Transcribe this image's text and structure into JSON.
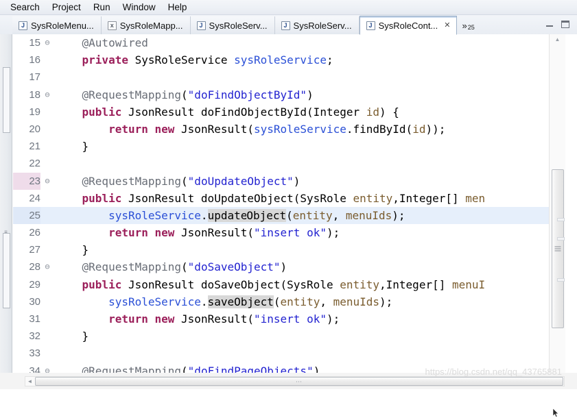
{
  "menubar": {
    "items": [
      {
        "label": "Search"
      },
      {
        "label": "Project"
      },
      {
        "label": "Run"
      },
      {
        "label": "Window"
      },
      {
        "label": "Help"
      }
    ]
  },
  "tabbar": {
    "tabs": [
      {
        "label": "SysRoleMenu...",
        "icon": "java-file-icon",
        "icon_glyph": "J",
        "type": "java",
        "active": false,
        "closable": false
      },
      {
        "label": "SysRoleMapp...",
        "icon": "xml-file-icon",
        "icon_glyph": "x",
        "type": "xml",
        "active": false,
        "closable": false
      },
      {
        "label": "SysRoleServ...",
        "icon": "java-file-icon",
        "icon_glyph": "J",
        "type": "java",
        "active": false,
        "closable": false
      },
      {
        "label": "SysRoleServ...",
        "icon": "java-file-icon",
        "icon_glyph": "J",
        "type": "java",
        "active": false,
        "closable": false
      },
      {
        "label": "SysRoleCont...",
        "icon": "java-file-icon",
        "icon_glyph": "J",
        "type": "java",
        "active": true,
        "closable": true
      }
    ],
    "close_glyph": "✕",
    "overflow_chevrons": "»",
    "overflow_count": "25",
    "window_buttons": {
      "minimize": "Minimize",
      "maximize": "Maximize"
    }
  },
  "editor": {
    "file": "SysRoleController.java",
    "first_line": 15,
    "lines": [
      {
        "no": "15",
        "fold": true,
        "changed": false,
        "current": false,
        "numhl": false,
        "tokens": [
          {
            "t": "    ",
            "c": "plain"
          },
          {
            "t": "@Autowired",
            "c": "ann"
          }
        ]
      },
      {
        "no": "16",
        "fold": false,
        "changed": false,
        "current": false,
        "numhl": false,
        "tokens": [
          {
            "t": "    ",
            "c": "plain"
          },
          {
            "t": "private",
            "c": "kw"
          },
          {
            "t": " SysRoleService ",
            "c": "plain"
          },
          {
            "t": "sysRoleService",
            "c": "fld"
          },
          {
            "t": ";",
            "c": "plain"
          }
        ]
      },
      {
        "no": "17",
        "fold": false,
        "changed": false,
        "current": false,
        "numhl": false,
        "tokens": []
      },
      {
        "no": "18",
        "fold": true,
        "changed": false,
        "current": false,
        "numhl": false,
        "tokens": [
          {
            "t": "    ",
            "c": "plain"
          },
          {
            "t": "@RequestMapping",
            "c": "ann"
          },
          {
            "t": "(",
            "c": "plain"
          },
          {
            "t": "\"doFindObjectById\"",
            "c": "str"
          },
          {
            "t": ")",
            "c": "plain"
          }
        ]
      },
      {
        "no": "19",
        "fold": false,
        "changed": false,
        "current": false,
        "numhl": false,
        "tokens": [
          {
            "t": "    ",
            "c": "plain"
          },
          {
            "t": "public",
            "c": "kw"
          },
          {
            "t": " JsonResult doFindObjectById(Integer ",
            "c": "plain"
          },
          {
            "t": "id",
            "c": "par"
          },
          {
            "t": ") {",
            "c": "plain"
          }
        ]
      },
      {
        "no": "20",
        "fold": false,
        "changed": false,
        "current": false,
        "numhl": false,
        "tokens": [
          {
            "t": "        ",
            "c": "plain"
          },
          {
            "t": "return",
            "c": "kw"
          },
          {
            "t": " ",
            "c": "plain"
          },
          {
            "t": "new",
            "c": "kw"
          },
          {
            "t": " JsonResult(",
            "c": "plain"
          },
          {
            "t": "sysRoleService",
            "c": "fld"
          },
          {
            "t": ".findById(",
            "c": "plain"
          },
          {
            "t": "id",
            "c": "par"
          },
          {
            "t": "));",
            "c": "plain"
          }
        ]
      },
      {
        "no": "21",
        "fold": false,
        "changed": false,
        "current": false,
        "numhl": false,
        "tokens": [
          {
            "t": "    }",
            "c": "plain"
          }
        ]
      },
      {
        "no": "22",
        "fold": false,
        "changed": false,
        "current": false,
        "numhl": false,
        "tokens": []
      },
      {
        "no": "23",
        "fold": true,
        "changed": true,
        "current": false,
        "numhl": true,
        "tokens": [
          {
            "t": "    ",
            "c": "plain"
          },
          {
            "t": "@RequestMapping",
            "c": "ann"
          },
          {
            "t": "(",
            "c": "plain"
          },
          {
            "t": "\"doUpdateObject\"",
            "c": "str"
          },
          {
            "t": ")",
            "c": "plain"
          }
        ]
      },
      {
        "no": "24",
        "fold": false,
        "changed": true,
        "current": false,
        "numhl": false,
        "tokens": [
          {
            "t": "    ",
            "c": "plain"
          },
          {
            "t": "public",
            "c": "kw"
          },
          {
            "t": " JsonResult doUpdateObject(SysRole ",
            "c": "plain"
          },
          {
            "t": "entity",
            "c": "par"
          },
          {
            "t": ",Integer[] ",
            "c": "plain"
          },
          {
            "t": "men",
            "c": "par"
          }
        ]
      },
      {
        "no": "25",
        "fold": false,
        "changed": true,
        "current": true,
        "numhl": true,
        "tokens": [
          {
            "t": "        ",
            "c": "plain"
          },
          {
            "t": "sysRoleService",
            "c": "fld"
          },
          {
            "t": ".",
            "c": "plain"
          },
          {
            "t": "update",
            "c": "occ"
          },
          {
            "t": "|",
            "c": "caret"
          },
          {
            "t": "Object",
            "c": "occ"
          },
          {
            "t": "(",
            "c": "plain"
          },
          {
            "t": "entity",
            "c": "par"
          },
          {
            "t": ", ",
            "c": "plain"
          },
          {
            "t": "menuIds",
            "c": "par"
          },
          {
            "t": ");",
            "c": "plain"
          }
        ]
      },
      {
        "no": "26",
        "fold": false,
        "changed": true,
        "current": false,
        "numhl": false,
        "tokens": [
          {
            "t": "        ",
            "c": "plain"
          },
          {
            "t": "return",
            "c": "kw"
          },
          {
            "t": " ",
            "c": "plain"
          },
          {
            "t": "new",
            "c": "kw"
          },
          {
            "t": " JsonResult(",
            "c": "plain"
          },
          {
            "t": "\"insert ok\"",
            "c": "str"
          },
          {
            "t": ");",
            "c": "plain"
          }
        ]
      },
      {
        "no": "27",
        "fold": false,
        "changed": true,
        "current": false,
        "numhl": false,
        "tokens": [
          {
            "t": "    }",
            "c": "plain"
          }
        ]
      },
      {
        "no": "28",
        "fold": true,
        "changed": false,
        "current": false,
        "numhl": false,
        "tokens": [
          {
            "t": "    ",
            "c": "plain"
          },
          {
            "t": "@RequestMapping",
            "c": "ann"
          },
          {
            "t": "(",
            "c": "plain"
          },
          {
            "t": "\"doSaveObject\"",
            "c": "str"
          },
          {
            "t": ")",
            "c": "plain"
          }
        ]
      },
      {
        "no": "29",
        "fold": false,
        "changed": false,
        "current": false,
        "numhl": false,
        "tokens": [
          {
            "t": "    ",
            "c": "plain"
          },
          {
            "t": "public",
            "c": "kw"
          },
          {
            "t": " JsonResult doSaveObject(SysRole ",
            "c": "plain"
          },
          {
            "t": "entity",
            "c": "par"
          },
          {
            "t": ",Integer[] ",
            "c": "plain"
          },
          {
            "t": "menuI",
            "c": "par"
          }
        ]
      },
      {
        "no": "30",
        "fold": false,
        "changed": false,
        "current": false,
        "numhl": false,
        "tokens": [
          {
            "t": "        ",
            "c": "plain"
          },
          {
            "t": "sysRoleService",
            "c": "fld"
          },
          {
            "t": ".",
            "c": "plain"
          },
          {
            "t": "saveObject",
            "c": "occ"
          },
          {
            "t": "(",
            "c": "plain"
          },
          {
            "t": "entity",
            "c": "par"
          },
          {
            "t": ", ",
            "c": "plain"
          },
          {
            "t": "menuIds",
            "c": "par"
          },
          {
            "t": ");",
            "c": "plain"
          }
        ]
      },
      {
        "no": "31",
        "fold": false,
        "changed": false,
        "current": false,
        "numhl": false,
        "tokens": [
          {
            "t": "        ",
            "c": "plain"
          },
          {
            "t": "return",
            "c": "kw"
          },
          {
            "t": " ",
            "c": "plain"
          },
          {
            "t": "new",
            "c": "kw"
          },
          {
            "t": " JsonResult(",
            "c": "plain"
          },
          {
            "t": "\"insert ok\"",
            "c": "str"
          },
          {
            "t": ");",
            "c": "plain"
          }
        ]
      },
      {
        "no": "32",
        "fold": false,
        "changed": false,
        "current": false,
        "numhl": false,
        "tokens": [
          {
            "t": "    }",
            "c": "plain"
          }
        ]
      },
      {
        "no": "33",
        "fold": false,
        "changed": false,
        "current": false,
        "numhl": false,
        "tokens": []
      },
      {
        "no": "34",
        "fold": true,
        "changed": false,
        "current": false,
        "numhl": false,
        "tokens": [
          {
            "t": "    ",
            "c": "plain"
          },
          {
            "t": "@RequestMapping",
            "c": "ann"
          },
          {
            "t": "(",
            "c": "plain"
          },
          {
            "t": "\"doFindPageObjects\"",
            "c": "str"
          },
          {
            "t": ")",
            "c": "plain"
          }
        ]
      }
    ],
    "fold_glyph": "⊖",
    "scroll": {
      "vertical_up_glyph": "▲",
      "h_left_glyph": "◄",
      "h_grip_glyph": "⋯"
    }
  },
  "watermark": {
    "text": "https://blog.csdn.net/qq_43765881"
  },
  "colors": {
    "keyword": "#9b1f5a",
    "string": "#2323d0",
    "annotation": "#686d76",
    "field": "#2a4fd6",
    "parameter": "#7a5c2e",
    "current_line": "#e6effb",
    "change_bar": "#3fb3e0",
    "occurrence": "#d8d8d8"
  }
}
